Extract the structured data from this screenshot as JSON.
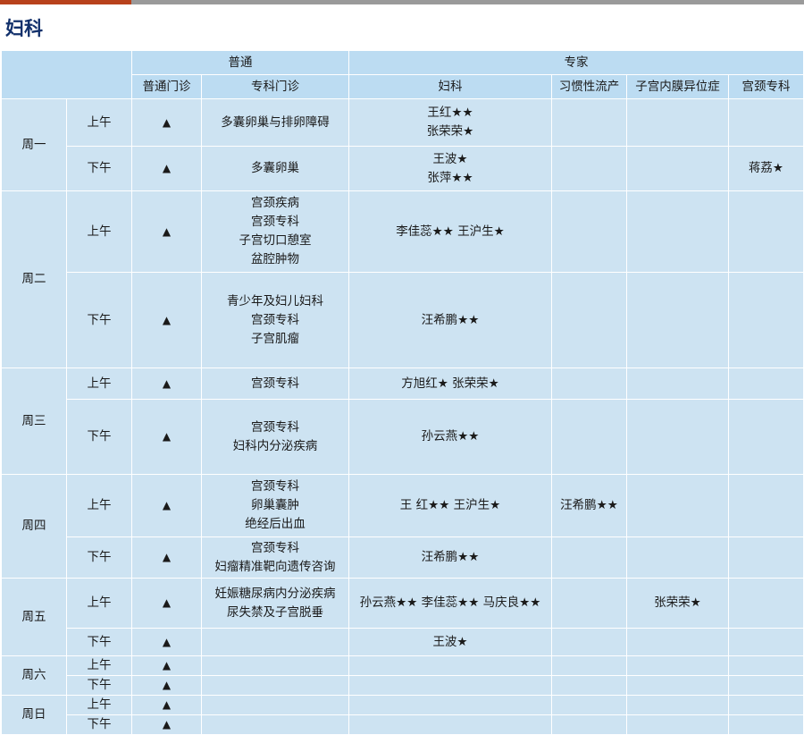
{
  "title": "妇科",
  "header": {
    "group_general": "普通",
    "group_expert": "专家",
    "col_general_clinic": "普通门诊",
    "col_specialty_clinic": "专科门诊",
    "col_gynecology": "妇科",
    "col_recurrent_miscarriage": "习惯性流产",
    "col_endometriosis": "子宫内膜异位症",
    "col_cervical": "宫颈专科"
  },
  "symbol": "▲",
  "schedule": {
    "mon": {
      "day": "周一",
      "am": {
        "period": "上午",
        "specialty": [
          "多囊卵巢与排卵障碍"
        ],
        "gyn": [
          "王红★★",
          "张荣荣★"
        ],
        "recurrent": "",
        "endo": "",
        "cervical": ""
      },
      "pm": {
        "period": "下午",
        "specialty": [
          "多囊卵巢"
        ],
        "gyn": [
          "王波★",
          "张萍★★"
        ],
        "recurrent": "",
        "endo": "",
        "cervical": "蒋荔★"
      }
    },
    "tue": {
      "day": "周二",
      "am": {
        "period": "上午",
        "specialty": [
          "宫颈疾病",
          "宫颈专科",
          "子宫切口憩室",
          "盆腔肿物"
        ],
        "gyn": [
          "李佳蕊★★ 王沪生★"
        ],
        "recurrent": "",
        "endo": "",
        "cervical": ""
      },
      "pm": {
        "period": "下午",
        "specialty": [
          "青少年及妇儿妇科",
          "宫颈专科",
          "子宫肌瘤"
        ],
        "gyn": [
          "汪希鹏★★"
        ],
        "recurrent": "",
        "endo": "",
        "cervical": ""
      }
    },
    "wed": {
      "day": "周三",
      "am": {
        "period": "上午",
        "specialty": [
          "宫颈专科"
        ],
        "gyn": [
          "方旭红★ 张荣荣★"
        ],
        "recurrent": "",
        "endo": "",
        "cervical": ""
      },
      "pm": {
        "period": "下午",
        "specialty": [
          "宫颈专科",
          "妇科内分泌疾病"
        ],
        "gyn": [
          "孙云燕★★"
        ],
        "recurrent": "",
        "endo": "",
        "cervical": ""
      }
    },
    "thu": {
      "day": "周四",
      "am": {
        "period": "上午",
        "specialty": [
          "宫颈专科",
          "卵巢囊肿",
          "绝经后出血"
        ],
        "gyn": [
          "王 红★★ 王沪生★"
        ],
        "recurrent": "汪希鹏★★",
        "endo": "",
        "cervical": ""
      },
      "pm": {
        "period": "下午",
        "specialty": [
          "宫颈专科",
          "妇瘤精准靶向遗传咨询"
        ],
        "gyn": [
          "汪希鹏★★"
        ],
        "recurrent": "",
        "endo": "",
        "cervical": ""
      }
    },
    "fri": {
      "day": "周五",
      "am": {
        "period": "上午",
        "specialty": [
          "妊娠糖尿病内分泌疾病",
          "尿失禁及子宫脱垂"
        ],
        "gyn": [
          "孙云燕★★ 李佳蕊★★ 马庆良★★"
        ],
        "recurrent": "",
        "endo": "张荣荣★",
        "cervical": ""
      },
      "pm": {
        "period": "下午",
        "specialty": [],
        "gyn": [
          "王波★"
        ],
        "recurrent": "",
        "endo": "",
        "cervical": ""
      }
    },
    "sat": {
      "day": "周六",
      "am": {
        "period": "上午"
      },
      "pm": {
        "period": "下午"
      }
    },
    "sun": {
      "day": "周日",
      "am": {
        "period": "上午"
      },
      "pm": {
        "period": "下午"
      }
    }
  }
}
